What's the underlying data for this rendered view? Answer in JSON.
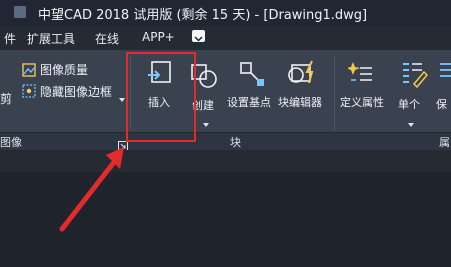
{
  "window": {
    "title": "中望CAD 2018 试用版 (剩余 15 天) - [Drawing1.dwg]"
  },
  "menubar": {
    "items": [
      {
        "label": "扩展工具"
      },
      {
        "label": "在线"
      },
      {
        "label": "APP+"
      }
    ]
  },
  "ribbon": {
    "image_panel": {
      "label": "图像",
      "buttons": [
        {
          "label": "图像质量"
        },
        {
          "label": "隐藏图像边框"
        }
      ],
      "clip_label": "剪"
    },
    "block_panel": {
      "label": "块",
      "buttons": [
        {
          "label": "插入"
        },
        {
          "label": "创建"
        },
        {
          "label": "设置基点"
        },
        {
          "label": "块编辑器"
        }
      ]
    },
    "attr_panel": {
      "label": "属",
      "buttons": [
        {
          "label": "定义属性"
        },
        {
          "label": "单个"
        },
        {
          "label": "保"
        }
      ]
    }
  },
  "colors": {
    "accent_red": "#e42b2b",
    "ribbon_bg": "#3a4250",
    "icon_blue": "#5fa8e8",
    "icon_yellow": "#f2c84b"
  }
}
